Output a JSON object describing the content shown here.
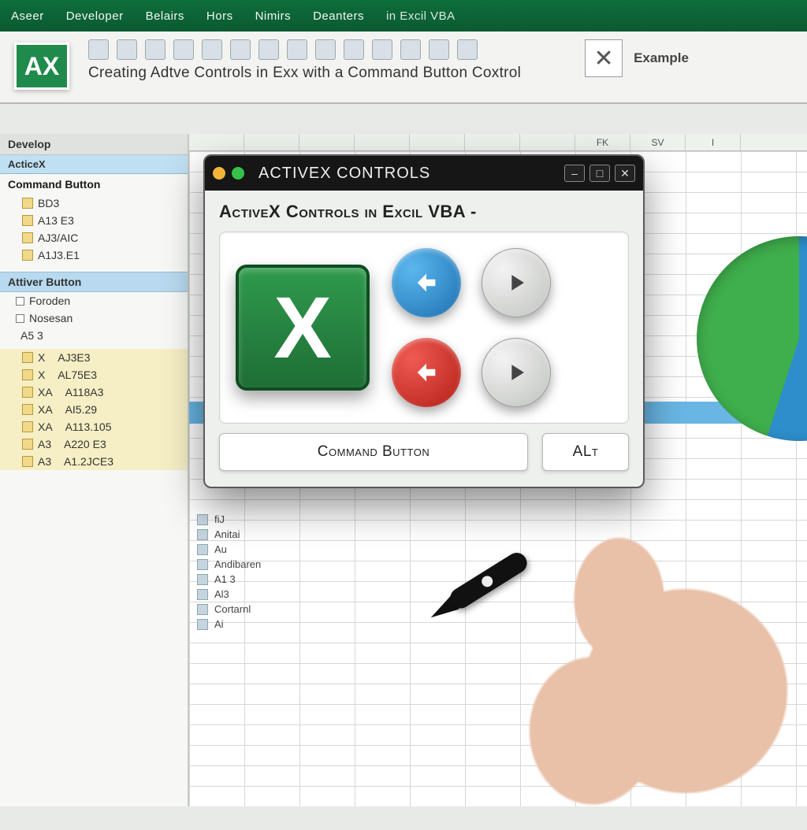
{
  "menubar": {
    "items": [
      "Aseer",
      "Developer",
      "Belairs",
      "Hors",
      "Nimirs",
      "Deanters"
    ],
    "tail": "in Excil VBA"
  },
  "ribbon": {
    "badge": "AX",
    "title": "Creating Adtve Controls in Exx with a Command Button Coxtrol",
    "example_label": "Example",
    "box_glyph": "✕"
  },
  "sidepanel": {
    "tab": "Develop",
    "section1": "ActiceX",
    "header1": "Command Button",
    "tree": [
      "BD3",
      "A13 E3",
      "AJ3/AIC",
      "A1J3.E1"
    ],
    "section2": "Attiver Button",
    "options": [
      "Foroden",
      "Nosesan"
    ],
    "option_extra": "A5 3",
    "yellow": [
      "X",
      "X",
      "XA",
      "XA",
      "XA",
      "A3",
      "A3"
    ],
    "yellow_vals": [
      "AJ3E3",
      "AL75E3",
      "A118A3",
      "AI5.29",
      "A113.105",
      "A220 E3",
      "A1.2JCE3"
    ]
  },
  "sheet": {
    "cols": [
      "",
      "FK",
      "SV",
      "I"
    ],
    "list2": [
      "fiJ",
      "Anitai",
      "Au",
      "Andibaren",
      "A1 3",
      "Al3",
      "Cortarnl",
      "Ai"
    ]
  },
  "dialog": {
    "title": "ACTIVEX CONTROLS",
    "subtitle": "ActiveX Controls in Excil VBA -",
    "big_button_glyph": "X",
    "cmd_button": "Command Button",
    "alt_button": "ALt"
  }
}
